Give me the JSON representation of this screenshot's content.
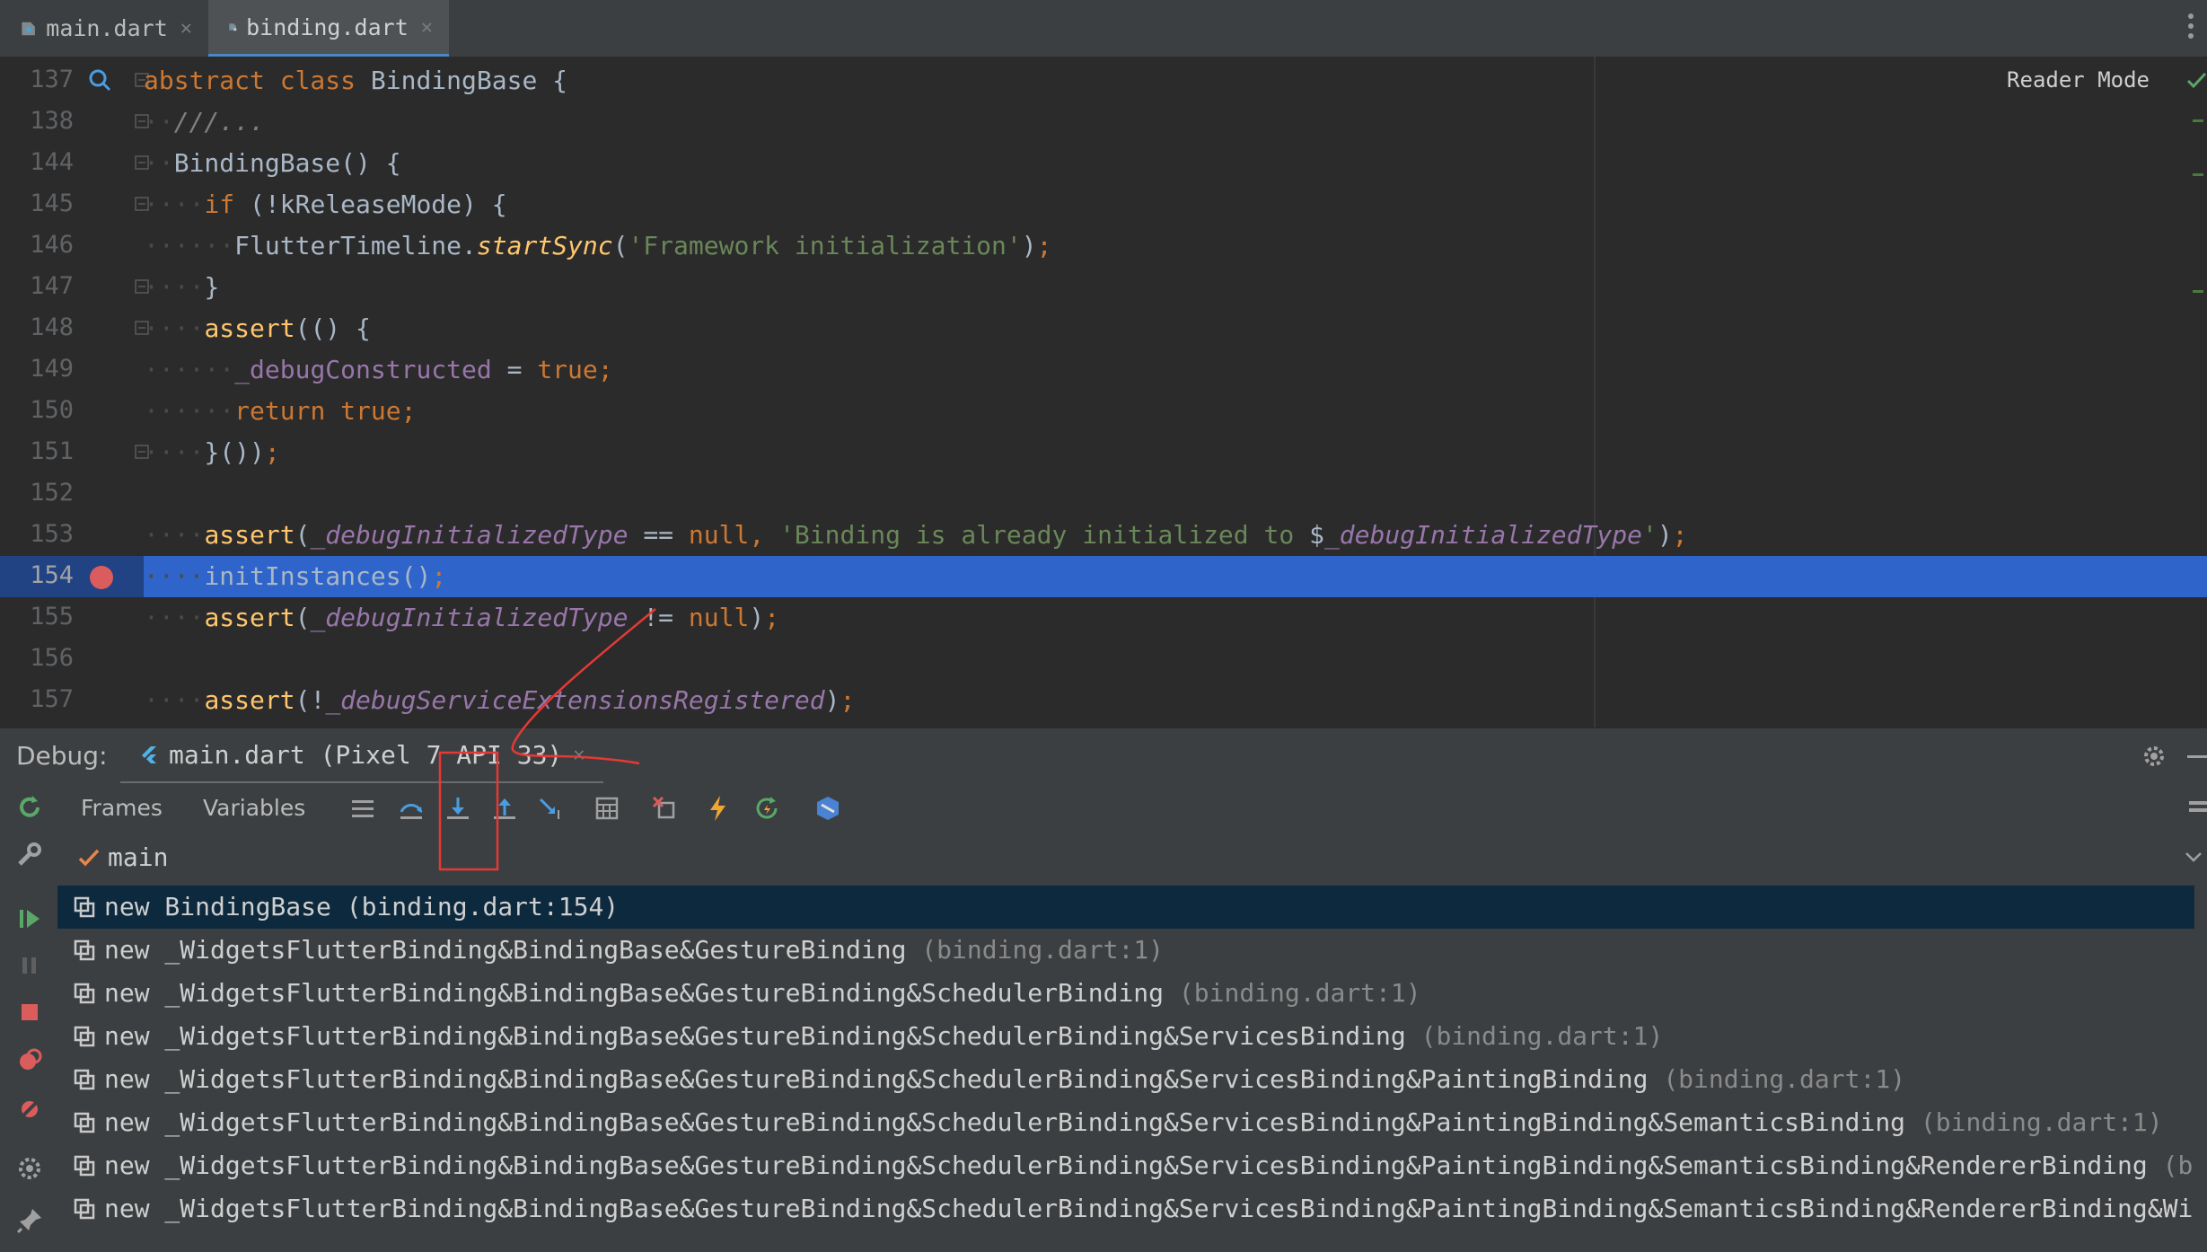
{
  "tabs": [
    {
      "label": "main.dart",
      "active": false
    },
    {
      "label": "binding.dart",
      "active": true
    }
  ],
  "editor": {
    "reader_mode": "Reader Mode",
    "lines": [
      {
        "num": "137",
        "html": "<span class=\"kw\">abstract class </span>BindingBase {"
      },
      {
        "num": "138",
        "html": "<span class=\"dots\">··</span><span class=\"cmt\">///...</span>"
      },
      {
        "num": "144",
        "html": "<span class=\"dots\">··</span>BindingBase() {"
      },
      {
        "num": "145",
        "html": "<span class=\"dots\">····</span><span class=\"kw\">if </span>(!kReleaseMode) {"
      },
      {
        "num": "146",
        "html": "<span class=\"dots\">······</span>FlutterTimeline.<span class=\"fn\">startSync</span>(<span class=\"str\">'Framework initialization'</span>)<span class=\"kw\">;</span>"
      },
      {
        "num": "147",
        "html": "<span class=\"dots\">····</span>}"
      },
      {
        "num": "148",
        "html": "<span class=\"dots\">····</span><span class=\"fn\" style=\"font-style:normal\">assert</span>(() {"
      },
      {
        "num": "149",
        "html": "<span class=\"dots\">······</span><span class=\"fld2\">_debugConstructed</span> = <span class=\"kw\">true;</span>"
      },
      {
        "num": "150",
        "html": "<span class=\"dots\">······</span><span class=\"kw\">return true;</span>"
      },
      {
        "num": "151",
        "html": "<span class=\"dots\">····</span>}())<span class=\"kw\">;</span>"
      },
      {
        "num": "152",
        "html": ""
      },
      {
        "num": "153",
        "html": "<span class=\"dots\">····</span><span class=\"fn\" style=\"font-style:normal\">assert</span>(<span class=\"fld\">_debugInitializedType</span> == <span class=\"kw\">null, </span><span class=\"str\">'Binding is already initialized to </span>$<span class=\"fld\">_debugInitializedType</span><span class=\"str\">'</span>)<span class=\"kw\">;</span>"
      },
      {
        "num": "154",
        "html": "<span class=\"dots\">····</span>initInstances()<span class=\"kw\">;</span>"
      },
      {
        "num": "155",
        "html": "<span class=\"dots\">····</span><span class=\"fn\" style=\"font-style:normal\">assert</span>(<span class=\"fld\">_debugInitializedType</span> != <span class=\"kw\">null</span>)<span class=\"kw\">;</span>"
      },
      {
        "num": "156",
        "html": ""
      },
      {
        "num": "157",
        "html": "<span class=\"dots\">····</span><span class=\"fn\" style=\"font-style:normal\">assert</span>(!<span class=\"fld\">_debugServiceExtensionsRegistered</span>)<span class=\"kw\">;</span>"
      }
    ]
  },
  "debug": {
    "label": "Debug:",
    "session": "main.dart (Pixel 7 API 33)",
    "subtabs": [
      "Frames",
      "Variables"
    ],
    "thread": "main",
    "frames": [
      {
        "name": "new BindingBase",
        "loc": "(binding.dart:154)"
      },
      {
        "name": "new _WidgetsFlutterBinding&BindingBase&GestureBinding",
        "loc": "(binding.dart:1)"
      },
      {
        "name": "new _WidgetsFlutterBinding&BindingBase&GestureBinding&SchedulerBinding",
        "loc": "(binding.dart:1)"
      },
      {
        "name": "new _WidgetsFlutterBinding&BindingBase&GestureBinding&SchedulerBinding&ServicesBinding",
        "loc": "(binding.dart:1)"
      },
      {
        "name": "new _WidgetsFlutterBinding&BindingBase&GestureBinding&SchedulerBinding&ServicesBinding&PaintingBinding",
        "loc": "(binding.dart:1)"
      },
      {
        "name": "new _WidgetsFlutterBinding&BindingBase&GestureBinding&SchedulerBinding&ServicesBinding&PaintingBinding&SemanticsBinding",
        "loc": "(binding.dart:1)"
      },
      {
        "name": "new _WidgetsFlutterBinding&BindingBase&GestureBinding&SchedulerBinding&ServicesBinding&PaintingBinding&SemanticsBinding&RendererBinding",
        "loc": "(bi"
      },
      {
        "name": "new _WidgetsFlutterBinding&BindingBase&GestureBinding&SchedulerBinding&ServicesBinding&PaintingBinding&SemanticsBinding&RendererBinding&Wid",
        "loc": ""
      }
    ]
  },
  "colors": {
    "accent": "#2f65ca",
    "breakpoint": "#db5c5c",
    "annotation": "#e53935"
  }
}
